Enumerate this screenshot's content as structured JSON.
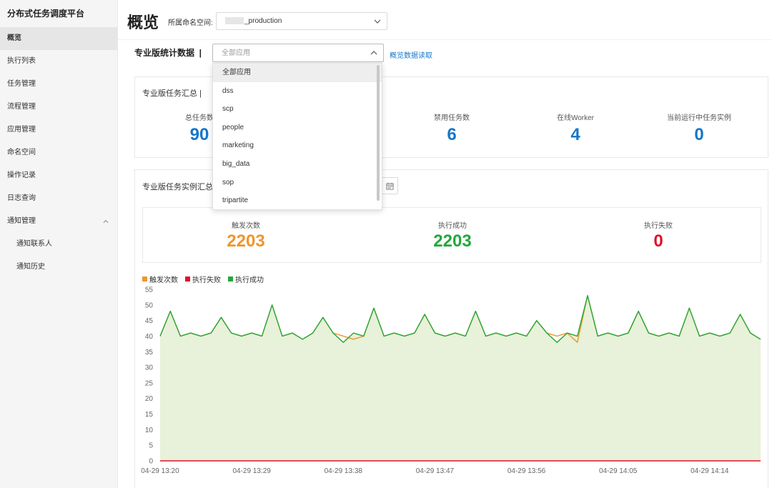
{
  "sidebar": {
    "brand": "分布式任务调度平台",
    "items": [
      {
        "label": "概览",
        "active": true
      },
      {
        "label": "执行列表"
      },
      {
        "label": "任务管理"
      },
      {
        "label": "流程管理"
      },
      {
        "label": "应用管理"
      },
      {
        "label": "命名空间"
      },
      {
        "label": "操作记录"
      },
      {
        "label": "日志查询"
      },
      {
        "label": "通知管理"
      }
    ],
    "sub_items": [
      {
        "label": "通知联系人"
      },
      {
        "label": "通知历史"
      }
    ]
  },
  "header": {
    "title": "概览",
    "namespace_label": "所属命名空间:",
    "namespace_value": "_production"
  },
  "stats_section": {
    "title": "专业版统计数据",
    "app_placeholder": "全部应用",
    "read_link": "概览数据读取"
  },
  "summary_card": {
    "title": "专业版任务汇总",
    "stats": [
      {
        "label": "总任务数",
        "value": "90",
        "color": "#1677c8"
      },
      {
        "label": "禁用任务数",
        "value": "6",
        "color": "#1677c8"
      },
      {
        "label": "在线Worker",
        "value": "4",
        "color": "#1677c8"
      },
      {
        "label": "当前运行中任务实例",
        "value": "0",
        "color": "#1677c8"
      }
    ]
  },
  "instance_card": {
    "title": "专业版任务实例汇总",
    "stats": [
      {
        "label": "触发次数",
        "value": "2203",
        "color": "#f0962a"
      },
      {
        "label": "执行成功",
        "value": "2203",
        "color": "#22a83a"
      },
      {
        "label": "执行失败",
        "value": "0",
        "color": "#e0102a"
      }
    ]
  },
  "dropdown": {
    "options": [
      "全部应用",
      "dss",
      "scp",
      "people",
      "marketing",
      "big_data",
      "sop",
      "tripartite"
    ],
    "selected": "全部应用"
  },
  "chart_data": {
    "type": "line",
    "x": [
      "04-29 13:20",
      "04-29 13:21",
      "04-29 13:22",
      "04-29 13:23",
      "04-29 13:24",
      "04-29 13:25",
      "04-29 13:26",
      "04-29 13:27",
      "04-29 13:28",
      "04-29 13:29",
      "04-29 13:30",
      "04-29 13:31",
      "04-29 13:32",
      "04-29 13:33",
      "04-29 13:34",
      "04-29 13:35",
      "04-29 13:36",
      "04-29 13:37",
      "04-29 13:38",
      "04-29 13:39",
      "04-29 13:40",
      "04-29 13:41",
      "04-29 13:42",
      "04-29 13:43",
      "04-29 13:44",
      "04-29 13:45",
      "04-29 13:46",
      "04-29 13:47",
      "04-29 13:48",
      "04-29 13:49",
      "04-29 13:50",
      "04-29 13:51",
      "04-29 13:52",
      "04-29 13:53",
      "04-29 13:54",
      "04-29 13:55",
      "04-29 13:56",
      "04-29 13:57",
      "04-29 13:58",
      "04-29 13:59",
      "04-29 14:00",
      "04-29 14:01",
      "04-29 14:02",
      "04-29 14:03",
      "04-29 14:04",
      "04-29 14:05",
      "04-29 14:06",
      "04-29 14:07",
      "04-29 14:08",
      "04-29 14:09",
      "04-29 14:10",
      "04-29 14:11",
      "04-29 14:12",
      "04-29 14:13",
      "04-29 14:14",
      "04-29 14:15",
      "04-29 14:16",
      "04-29 14:17",
      "04-29 14:18",
      "04-29 14:19"
    ],
    "x_tick_labels": [
      "04-29 13:20",
      "04-29 13:29",
      "04-29 13:38",
      "04-29 13:47",
      "04-29 13:56",
      "04-29 14:05",
      "04-29 14:14"
    ],
    "series": [
      {
        "name": "触发次数",
        "color": "#f0962a",
        "values": [
          40,
          48,
          40,
          41,
          40,
          41,
          46,
          41,
          40,
          41,
          40,
          50,
          40,
          41,
          39,
          41,
          46,
          41,
          40,
          39,
          40,
          49,
          40,
          41,
          40,
          41,
          47,
          41,
          40,
          41,
          40,
          48,
          40,
          41,
          40,
          41,
          40,
          45,
          41,
          40,
          41,
          38,
          53,
          40,
          41,
          40,
          41,
          48,
          41,
          40,
          41,
          40,
          49,
          40,
          41,
          40,
          41,
          47,
          41,
          39
        ]
      },
      {
        "name": "执行失败",
        "color": "#e0102a",
        "values": [
          0,
          0,
          0,
          0,
          0,
          0,
          0,
          0,
          0,
          0,
          0,
          0,
          0,
          0,
          0,
          0,
          0,
          0,
          0,
          0,
          0,
          0,
          0,
          0,
          0,
          0,
          0,
          0,
          0,
          0,
          0,
          0,
          0,
          0,
          0,
          0,
          0,
          0,
          0,
          0,
          0,
          0,
          0,
          0,
          0,
          0,
          0,
          0,
          0,
          0,
          0,
          0,
          0,
          0,
          0,
          0,
          0,
          0,
          0,
          0
        ]
      },
      {
        "name": "执行成功",
        "color": "#22a83a",
        "values": [
          40,
          48,
          40,
          41,
          40,
          41,
          46,
          41,
          40,
          41,
          40,
          50,
          40,
          41,
          39,
          41,
          46,
          41,
          38,
          41,
          40,
          49,
          40,
          41,
          40,
          41,
          47,
          41,
          40,
          41,
          40,
          48,
          40,
          41,
          40,
          41,
          40,
          45,
          41,
          38,
          41,
          40,
          53,
          40,
          41,
          40,
          41,
          48,
          41,
          40,
          41,
          40,
          49,
          40,
          41,
          40,
          41,
          47,
          41,
          39
        ]
      }
    ],
    "ylim": [
      0,
      55
    ],
    "y_ticks": [
      0,
      5,
      10,
      15,
      20,
      25,
      30,
      35,
      40,
      45,
      50,
      55
    ],
    "legend": "top-left",
    "grid": false
  }
}
